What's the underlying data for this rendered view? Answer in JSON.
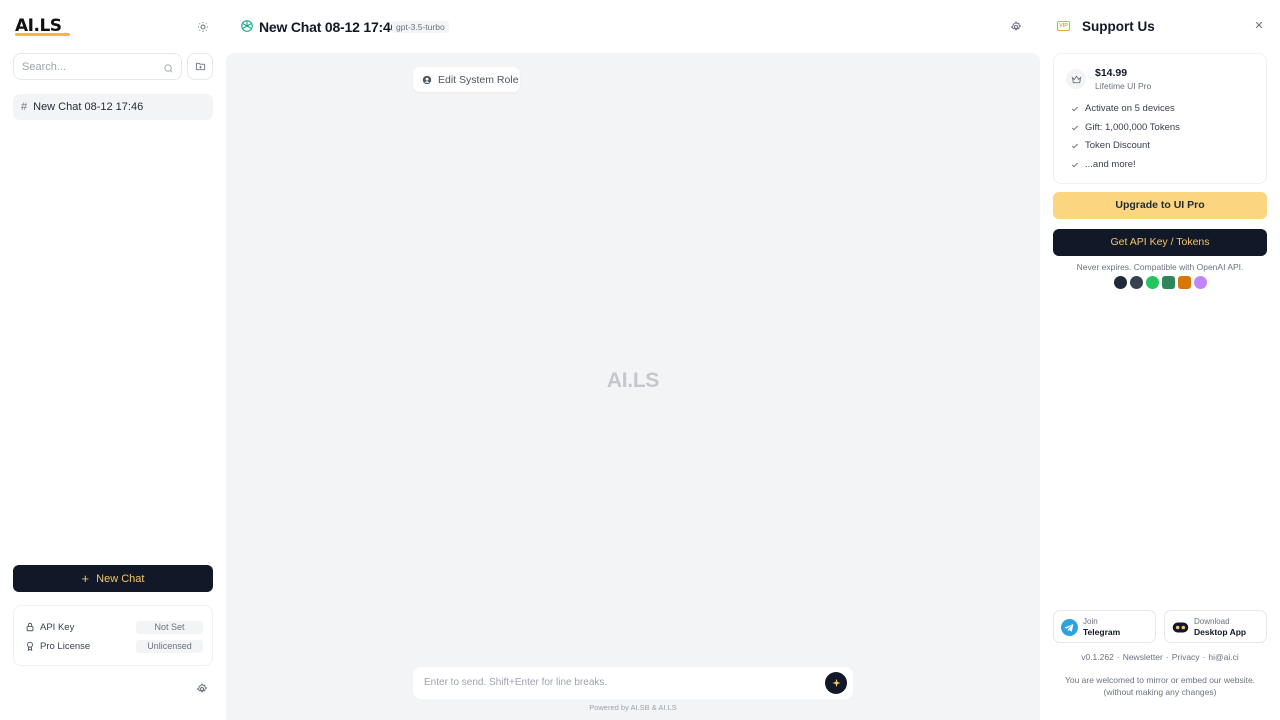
{
  "sidebar": {
    "logo": "AI.LS",
    "search_placeholder": "Search...",
    "chats": [
      {
        "title": "New Chat 08-12 17:46"
      }
    ],
    "new_chat_label": "New Chat",
    "status": {
      "api_key_label": "API Key",
      "api_key_value": "Not Set",
      "pro_license_label": "Pro License",
      "pro_license_value": "Unlicensed"
    }
  },
  "header": {
    "chat_title": "New Chat 08-12 17:46",
    "model": "gpt-3.5-turbo"
  },
  "main": {
    "edit_system_role_label": "Edit System Role",
    "watermark": "AI.LS",
    "input_placeholder": "Enter to send. Shift+Enter for line breaks.",
    "powered_by": "Powered by AI.SB & AI.LS"
  },
  "right_panel": {
    "title": "Support Us",
    "vip_badge": "VIP",
    "price": "$14.99",
    "price_sub": "Lifetime UI Pro",
    "features": [
      "Activate on 5 devices",
      "Gift: 1,000,000 Tokens",
      "Token Discount",
      "...and more!"
    ],
    "upgrade_label": "Upgrade to UI Pro",
    "api_key_button_label": "Get API Key / Tokens",
    "never_expires": "Never expires. Compatible with OpenAI API.",
    "provider_icons": [
      "openai-icon",
      "panda-icon",
      "green-leaf-icon",
      "shield-icon",
      "sandwich-icon",
      "atom-icon"
    ],
    "provider_colors": [
      "#1f2937",
      "#374151",
      "#22c55e",
      "#2f855a",
      "#d97706",
      "#c084fc"
    ],
    "telegram": {
      "line1": "Join",
      "line2": "Telegram"
    },
    "desktop": {
      "line1": "Download",
      "line2": "Desktop App"
    },
    "footer": {
      "version": "v0.1.262",
      "newsletter": "Newsletter",
      "privacy": "Privacy",
      "email": "hi@ai.ci"
    },
    "mirror_line1": "You are welcomed to mirror or embed our website.",
    "mirror_line2": "(without making any changes)"
  },
  "colors": {
    "accent": "#f5c56b",
    "dark": "#111827",
    "upgrade": "#fcd57f",
    "gpt_green": "#10a37f"
  }
}
